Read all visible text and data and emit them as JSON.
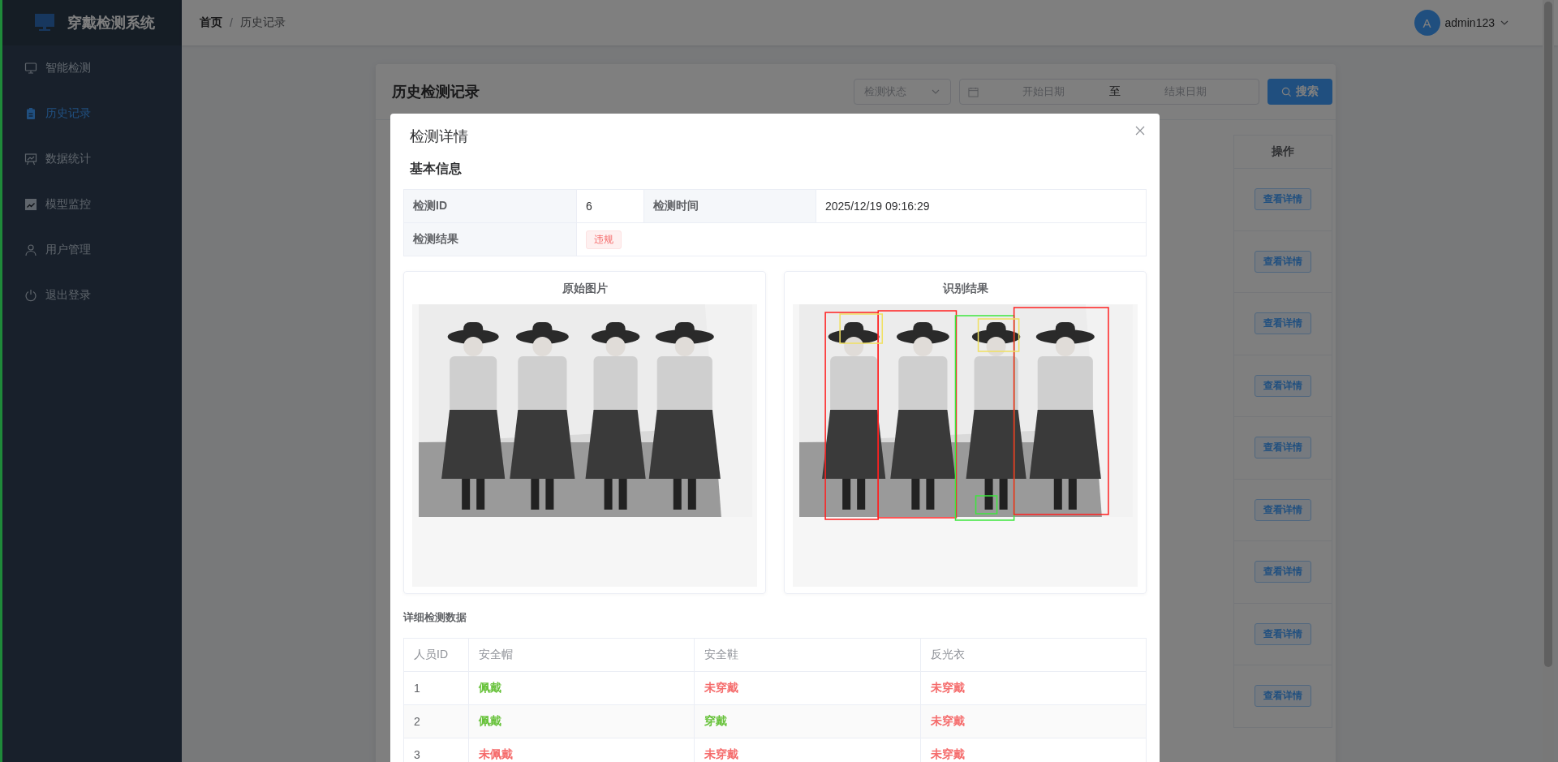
{
  "sidebar": {
    "app_title": "穿戴检测系统",
    "items": [
      {
        "label": "智能检测",
        "selected": false
      },
      {
        "label": "历史记录",
        "selected": true
      },
      {
        "label": "数据统计",
        "selected": false
      },
      {
        "label": "模型监控",
        "selected": false
      },
      {
        "label": "用户管理",
        "selected": false
      },
      {
        "label": "退出登录",
        "selected": false
      }
    ]
  },
  "header": {
    "breadcrumb": [
      {
        "label": "首页",
        "current": false
      },
      {
        "label": "历史记录",
        "current": true
      }
    ],
    "separator": "/",
    "user": {
      "avatar": "A",
      "name": "admin123"
    }
  },
  "history": {
    "title": "历史检测记录",
    "filters": {
      "status_placeholder": "检测状态",
      "start_placeholder": "开始日期",
      "separator": "至",
      "end_placeholder": "结束日期",
      "search_button": "搜索"
    },
    "table": {
      "column": "操作",
      "rows": [
        "查看详情",
        "查看详情",
        "查看详情",
        "查看详情",
        "查看详情",
        "查看详情",
        "查看详情",
        "查看详情",
        "查看详情"
      ]
    }
  },
  "dialog": {
    "title": "检测详情",
    "basic_title": "基本信息",
    "fields": [
      {
        "label": "检测ID",
        "value": "6"
      },
      {
        "label": "检测时间",
        "value": "2025/12/19 09:16:29"
      }
    ],
    "result": {
      "label": "检测结果",
      "value": "违规",
      "kind": "danger"
    },
    "images": [
      {
        "title": "原始图片",
        "kind": "original"
      },
      {
        "title": "识别结果",
        "kind": "annotated"
      }
    ],
    "detail_title": "详细检测数据",
    "columns": [
      "人员ID",
      "安全帽",
      "安全鞋",
      "反光衣"
    ],
    "rows": [
      {
        "cells": [
          {
            "text": "1",
            "kind": "plain"
          },
          {
            "text": "佩戴",
            "kind": "ok"
          },
          {
            "text": "未穿戴",
            "kind": "bad"
          },
          {
            "text": "未穿戴",
            "kind": "bad"
          }
        ]
      },
      {
        "cells": [
          {
            "text": "2",
            "kind": "plain"
          },
          {
            "text": "佩戴",
            "kind": "ok"
          },
          {
            "text": "穿戴",
            "kind": "ok"
          },
          {
            "text": "未穿戴",
            "kind": "bad"
          }
        ]
      },
      {
        "cells": [
          {
            "text": "3",
            "kind": "plain"
          },
          {
            "text": "未佩戴",
            "kind": "bad"
          },
          {
            "text": "未穿戴",
            "kind": "bad"
          },
          {
            "text": "未穿戴",
            "kind": "bad"
          }
        ]
      }
    ]
  }
}
